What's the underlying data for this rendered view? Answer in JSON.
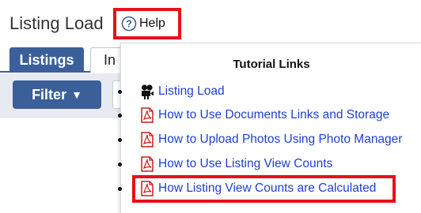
{
  "header": {
    "title": "Listing Load",
    "help_label": "Help",
    "help_icon": "question-circle-icon"
  },
  "tabs": [
    {
      "label": "Listings",
      "active": true
    },
    {
      "label": "In",
      "active": false
    }
  ],
  "toolbar": {
    "filter_label": "Filter",
    "filter_caret": "▼"
  },
  "tutorial": {
    "heading": "Tutorial Links",
    "links": [
      {
        "label": "Listing Load",
        "icon": "film-camera-icon"
      },
      {
        "label": "How to Use Documents Links and Storage",
        "icon": "pdf-icon"
      },
      {
        "label": "How to Upload Photos Using Photo Manager",
        "icon": "pdf-icon"
      },
      {
        "label": "How to Use Listing View Counts",
        "icon": "pdf-icon"
      },
      {
        "label": "How Listing View Counts are Calculated",
        "icon": "pdf-icon",
        "highlighted": true
      }
    ]
  },
  "colors": {
    "accent": "#3b5f99",
    "highlight": "#e8101a",
    "link": "#1f3fcf",
    "toolbar_bg": "#e7ebf1"
  }
}
